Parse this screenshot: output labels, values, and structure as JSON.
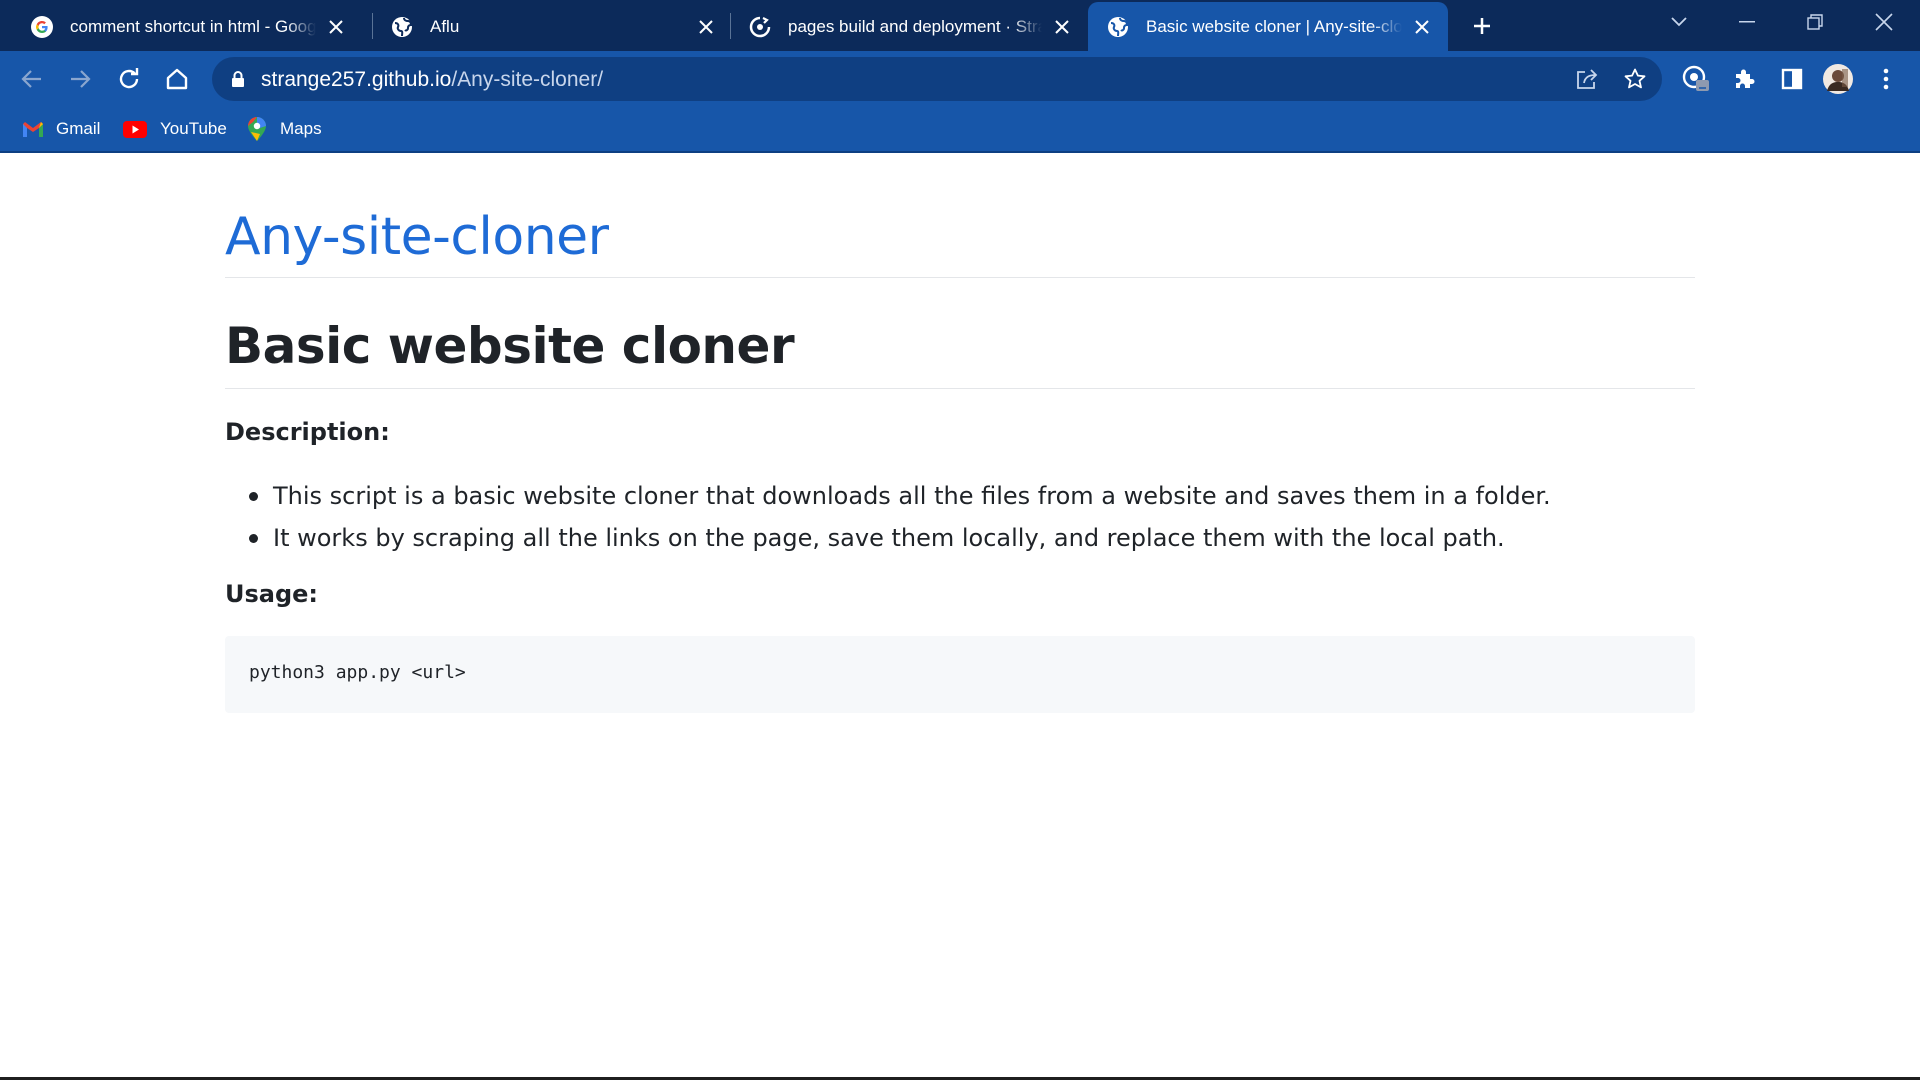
{
  "browser": {
    "tabs": [
      {
        "title": "comment shortcut in html - Google",
        "icon": "google-g-icon",
        "active": false
      },
      {
        "title": "Aflu",
        "icon": "globe-icon",
        "active": false
      },
      {
        "title": "pages build and deployment · Strange",
        "icon": "github-actions-icon",
        "active": false
      },
      {
        "title": "Basic website cloner | Any-site-cloner",
        "icon": "globe-icon",
        "active": true
      }
    ],
    "address": {
      "host": "strange257.github.io",
      "path": "/Any-site-cloner/"
    },
    "bookmarks": [
      {
        "label": "Gmail",
        "icon": "gmail-icon"
      },
      {
        "label": "YouTube",
        "icon": "youtube-icon"
      },
      {
        "label": "Maps",
        "icon": "maps-icon"
      }
    ],
    "colors": {
      "tabstrip": "#0c2a5a",
      "toolbar": "#1756a9",
      "omnibox": "#0f3f82"
    }
  },
  "page": {
    "site_title": "Any-site-cloner",
    "heading": "Basic website cloner",
    "description_heading": "Description:",
    "description_items": [
      "This script is a basic website cloner that downloads all the files from a website and saves them in a folder.",
      "It works by scraping all the links on the page, save them locally, and replace them with the local path."
    ],
    "usage_heading": "Usage:",
    "usage_code": "python3 app.py <url>",
    "colors": {
      "link": "#1e6bd6",
      "text": "#1f2328",
      "code_bg": "#f6f8fa"
    }
  }
}
